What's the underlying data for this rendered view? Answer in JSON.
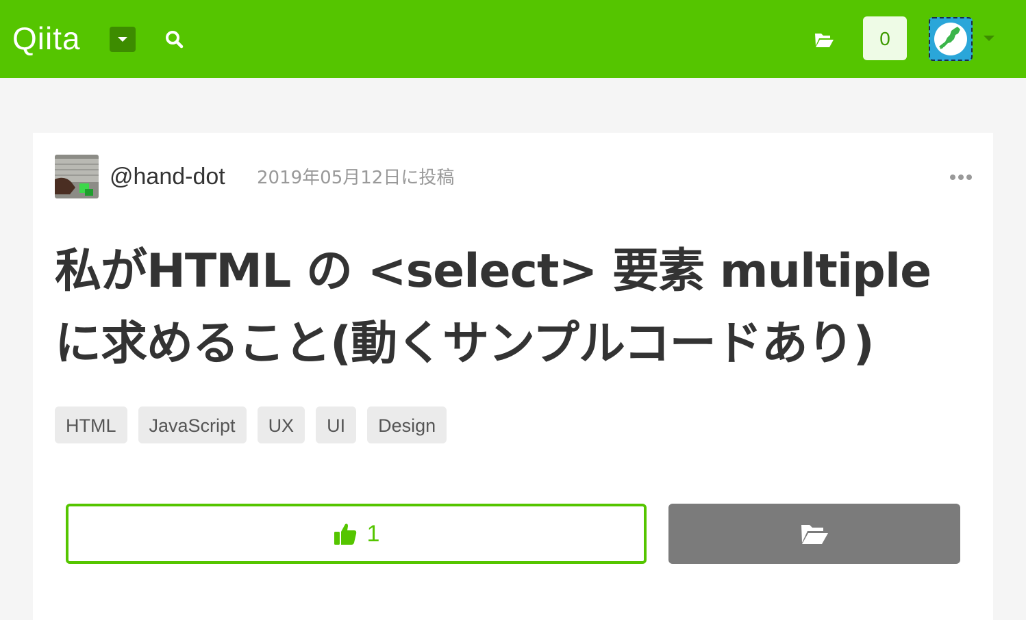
{
  "header": {
    "logo_text": "Qiita",
    "brand_color": "#55c500",
    "notification_count": "0",
    "icons": [
      "caret-down-icon",
      "search-icon",
      "folder-open-icon",
      "user-avatar",
      "caret-down-icon"
    ]
  },
  "article": {
    "author": "@hand-dot",
    "posted_date": "2019年05月12日に投稿",
    "title": "私がHTML の <select> 要素 multiple に求めること(動くサンプルコードあり)",
    "tags": [
      "HTML",
      "JavaScript",
      "UX",
      "UI",
      "Design"
    ],
    "like_count": "1"
  }
}
